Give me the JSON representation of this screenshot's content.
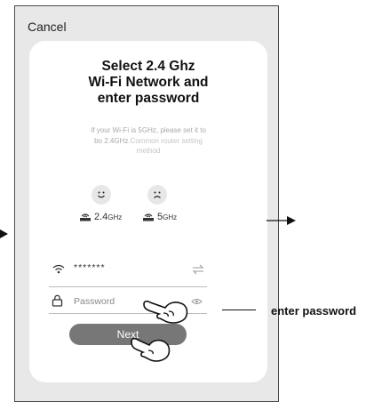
{
  "header": {
    "cancel_label": "Cancel"
  },
  "title": {
    "line1": "Select 2.4 Ghz",
    "line2": "Wi-Fi Network and",
    "line3": "enter password"
  },
  "description": {
    "line1": "If your Wi-Fi is 5GHz, please set it to",
    "line2_prefix": "bo 2.4GHz.",
    "line2_link": "Common router setting",
    "line3": "method"
  },
  "bands": [
    {
      "label_big": "2.4",
      "label_small": "GHz",
      "status": "happy",
      "icon": "router-icon"
    },
    {
      "label_big": "5",
      "label_small": "GHz",
      "status": "sad",
      "icon": "router-icon"
    }
  ],
  "wifi_field": {
    "value": "*******",
    "icon": "wifi-icon",
    "action_icon": "switch-arrows-icon"
  },
  "password_field": {
    "placeholder": "Password",
    "icon": "lock-icon",
    "action_icon": "eye-icon"
  },
  "next_button": {
    "label": "Next"
  },
  "annotation": {
    "label": "enter password"
  },
  "colors": {
    "phone_bg": "#e8e8e8",
    "button_bg": "#777777",
    "muted_text": "#a9a9a9"
  }
}
